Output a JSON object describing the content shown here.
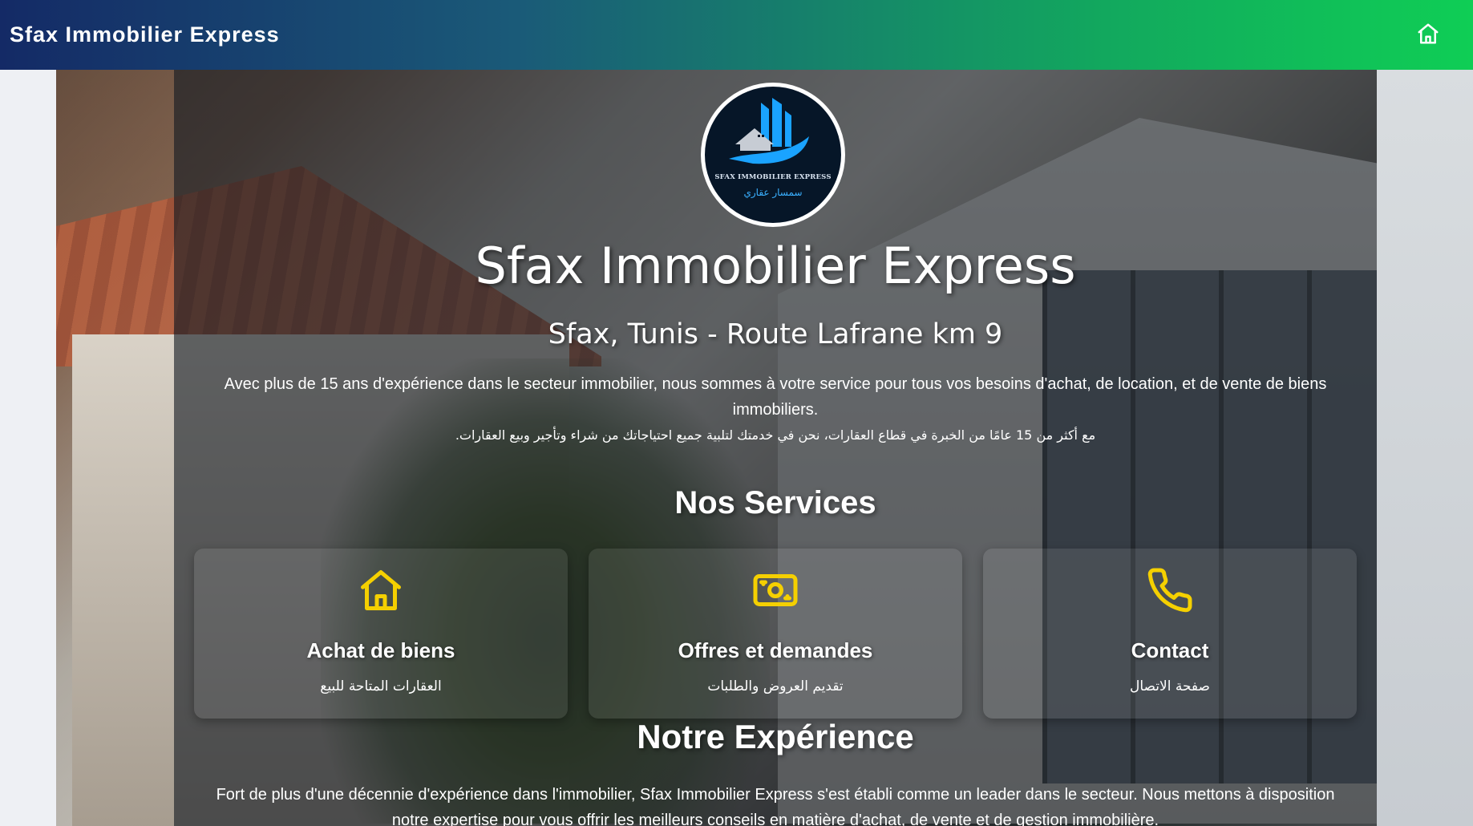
{
  "navbar": {
    "brand": "Sfax Immobilier Express",
    "home_icon": "home-icon",
    "gradient": [
      "#142a66",
      "#0fce55"
    ]
  },
  "logo": {
    "caption_en": "SFAX IMMOBILIER EXPRESS",
    "caption_ar": "سمسار عقاري"
  },
  "hero": {
    "title": "Sfax Immobilier Express",
    "subtitle": "Sfax, Tunis - Route Lafrane km 9",
    "intro_fr": "Avec plus de 15 ans d'expérience dans le secteur immobilier, nous sommes à votre service pour tous vos besoins d'achat, de location, et de vente de biens immobiliers.",
    "intro_ar": "مع أكثر من 15 عامًا من الخبرة في قطاع العقارات، نحن في خدمتك لتلبية جميع احتياجاتك من شراء وتأجير وبيع العقارات."
  },
  "services": {
    "heading": "Nos Services",
    "icon_color": "#f5d000",
    "items": [
      {
        "label": "Achat de biens",
        "label_ar": "العقارات المتاحة للبيع",
        "icon": "home-icon"
      },
      {
        "label": "Offres et demandes",
        "label_ar": "تقديم العروض والطلبات",
        "icon": "cash-icon"
      },
      {
        "label": "Contact",
        "label_ar": "صفحة الاتصال",
        "icon": "phone-icon"
      }
    ]
  },
  "experience": {
    "heading": "Notre Expérience",
    "text": "Fort de plus d'une décennie d'expérience dans l'immobilier, Sfax Immobilier Express s'est établi comme un leader dans le secteur. Nous mettons à disposition notre expertise pour vous offrir les meilleurs conseils en matière d'achat, de vente et de gestion immobilière."
  }
}
